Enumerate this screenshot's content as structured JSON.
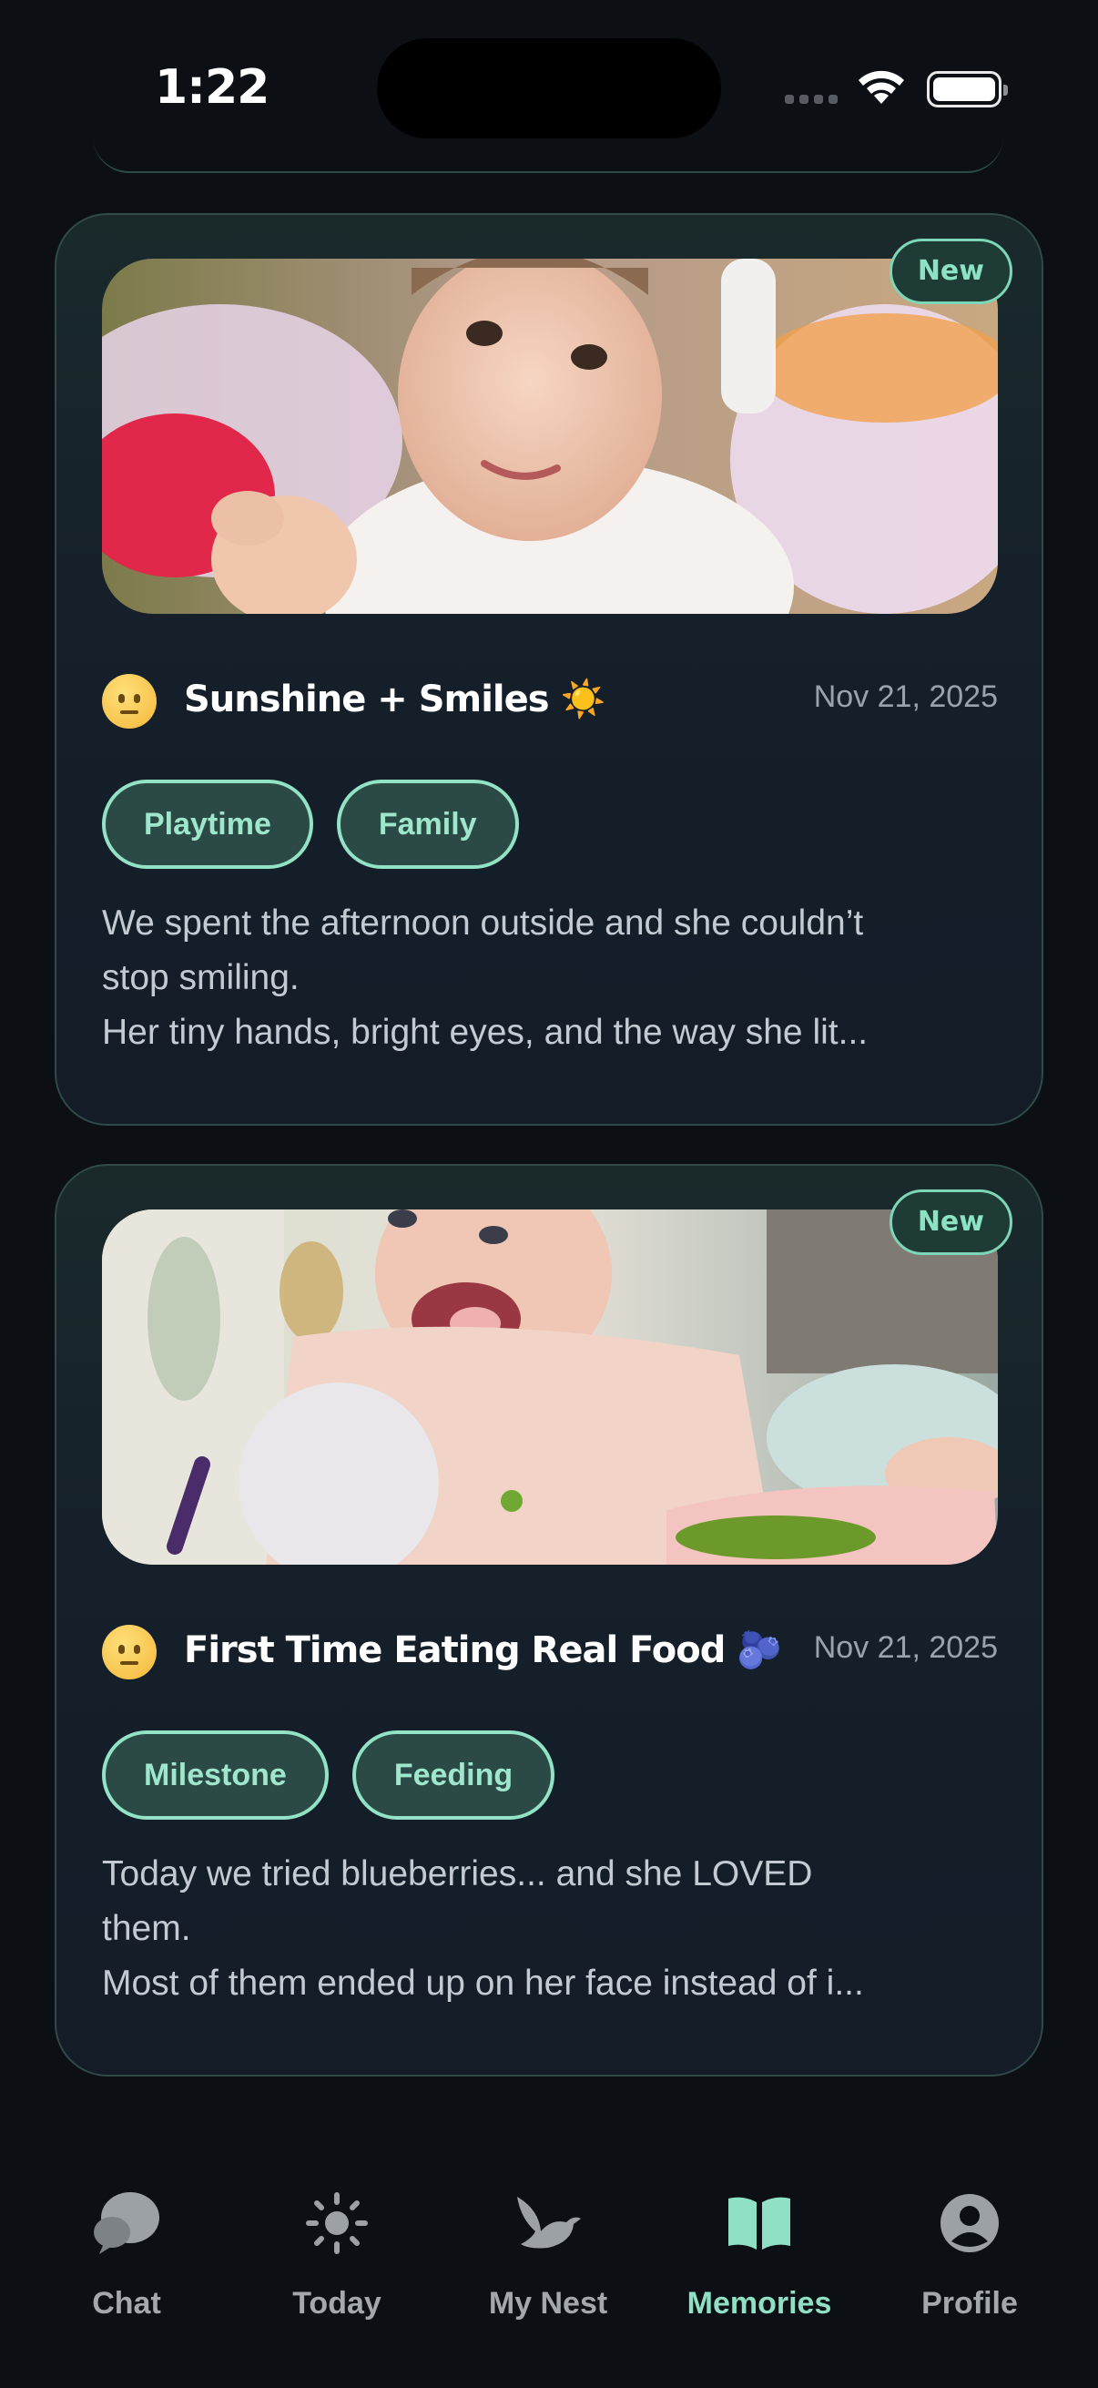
{
  "status_bar": {
    "time": "1:22"
  },
  "cards": [
    {
      "badge": "New",
      "title": "Sunshine + Smiles ☀️",
      "date": "Nov 21, 2025",
      "tags": [
        "Playtime",
        "Family"
      ],
      "description": [
        "We spent the afternoon outside and she couldn’t",
        "stop smiling.",
        "Her tiny hands, bright eyes, and the way she lit..."
      ]
    },
    {
      "badge": "New",
      "title": "First Time Eating Real Food 🫐...",
      "date": "Nov 21, 2025",
      "tags": [
        "Milestone",
        "Feeding"
      ],
      "description": [
        "Today we tried blueberries... and she LOVED",
        "them.",
        "Most of them ended up on her face instead of i..."
      ]
    }
  ],
  "tab_bar": {
    "tabs": [
      {
        "label": "Chat",
        "icon": "chat-bubbles-icon",
        "active": false
      },
      {
        "label": "Today",
        "icon": "sun-icon",
        "active": false
      },
      {
        "label": "My Nest",
        "icon": "bird-icon",
        "active": false
      },
      {
        "label": "Memories",
        "icon": "book-icon",
        "active": true
      },
      {
        "label": "Profile",
        "icon": "profile-icon",
        "active": false
      }
    ]
  },
  "colors": {
    "accent": "#8fe0c4",
    "background": "#0c1014",
    "tag_border": "#92e2c6"
  }
}
